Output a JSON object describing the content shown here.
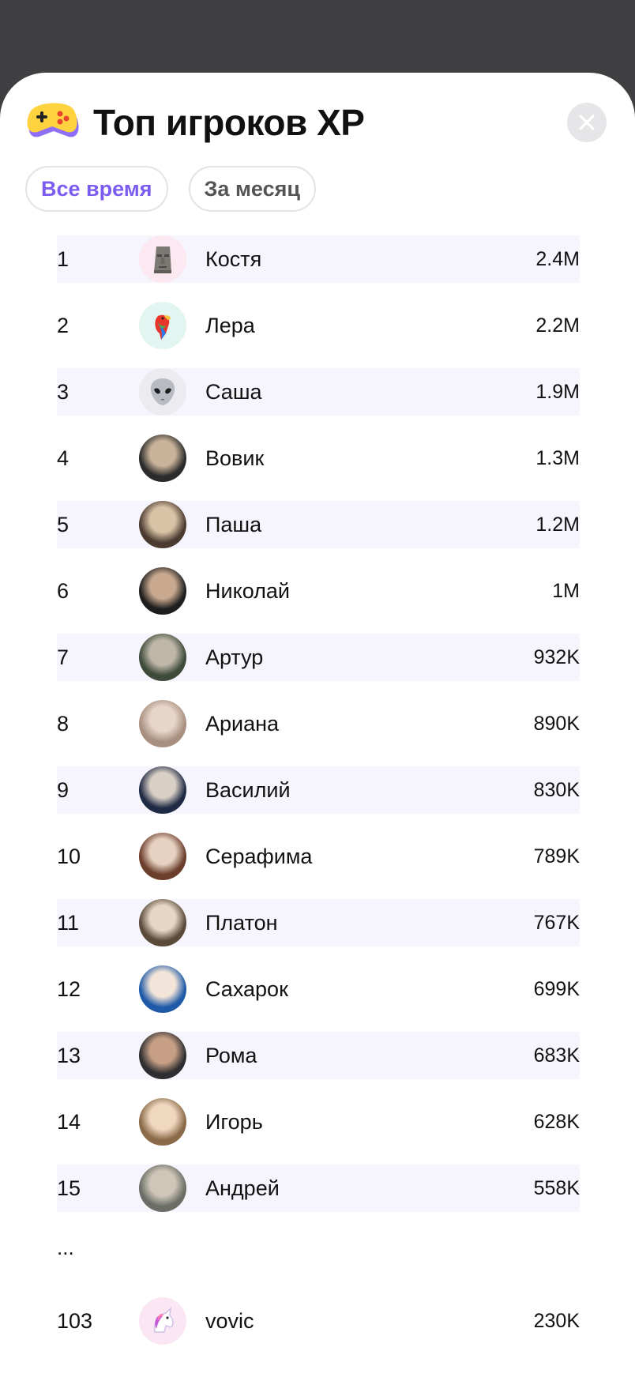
{
  "header": {
    "title": "Топ игроков XP",
    "icon": "game-controller-icon"
  },
  "tabs": [
    {
      "label": "Все время",
      "active": true
    },
    {
      "label": "За месяц",
      "active": false
    }
  ],
  "accent_color": "#7c5cf0",
  "players": [
    {
      "rank": "1",
      "name": "Костя",
      "xp": "2.4M",
      "avatar": "moai-emoji-avatar"
    },
    {
      "rank": "2",
      "name": "Лера",
      "xp": "2.2M",
      "avatar": "parrot-emoji-avatar"
    },
    {
      "rank": "3",
      "name": "Саша",
      "xp": "1.9M",
      "avatar": "alien-emoji-avatar"
    },
    {
      "rank": "4",
      "name": "Вовик",
      "xp": "1.3M",
      "avatar": "photo-avatar"
    },
    {
      "rank": "5",
      "name": "Паша",
      "xp": "1.2M",
      "avatar": "photo-avatar"
    },
    {
      "rank": "6",
      "name": "Николай",
      "xp": "1M",
      "avatar": "photo-avatar"
    },
    {
      "rank": "7",
      "name": "Артур",
      "xp": "932K",
      "avatar": "photo-avatar"
    },
    {
      "rank": "8",
      "name": "Ариана",
      "xp": "890K",
      "avatar": "photo-avatar"
    },
    {
      "rank": "9",
      "name": "Василий",
      "xp": "830K",
      "avatar": "photo-avatar"
    },
    {
      "rank": "10",
      "name": "Серафима",
      "xp": "789K",
      "avatar": "photo-avatar"
    },
    {
      "rank": "11",
      "name": "Платон",
      "xp": "767K",
      "avatar": "photo-avatar"
    },
    {
      "rank": "12",
      "name": "Сахарок",
      "xp": "699K",
      "avatar": "photo-avatar"
    },
    {
      "rank": "13",
      "name": "Рома",
      "xp": "683K",
      "avatar": "photo-avatar"
    },
    {
      "rank": "14",
      "name": "Игорь",
      "xp": "628K",
      "avatar": "photo-avatar"
    },
    {
      "rank": "15",
      "name": "Андрей",
      "xp": "558K",
      "avatar": "photo-avatar"
    }
  ],
  "ellipsis": "...",
  "current_user": {
    "rank": "103",
    "name": "vovic",
    "xp": "230K",
    "avatar": "unicorn-emoji-avatar"
  }
}
